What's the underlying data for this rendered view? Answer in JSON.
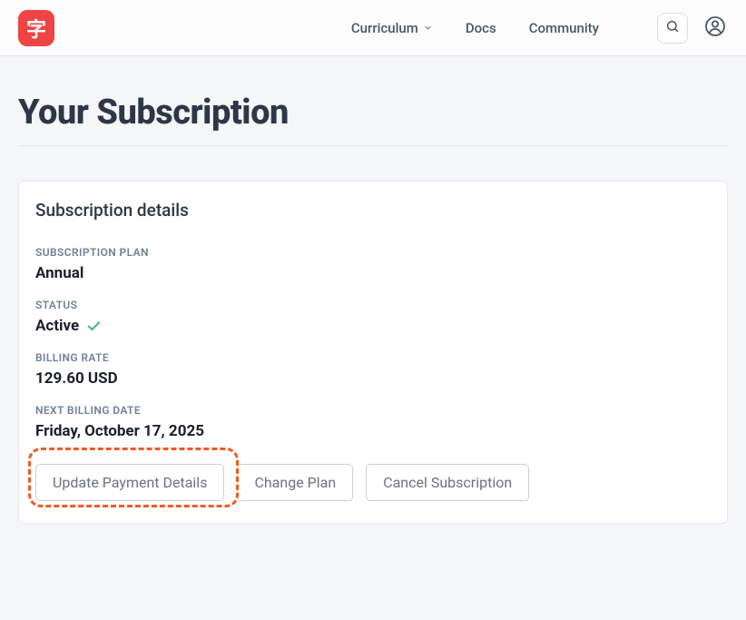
{
  "header": {
    "logo_char": "字",
    "nav": {
      "curriculum": "Curriculum",
      "docs": "Docs",
      "community": "Community"
    }
  },
  "page": {
    "title": "Your Subscription"
  },
  "card": {
    "title": "Subscription details",
    "labels": {
      "plan": "SUBSCRIPTION PLAN",
      "status": "STATUS",
      "billing_rate": "BILLING RATE",
      "next_billing": "NEXT BILLING DATE"
    },
    "values": {
      "plan": "Annual",
      "status": "Active",
      "billing_rate": "129.60 USD",
      "next_billing": "Friday, October 17, 2025"
    },
    "buttons": {
      "update_payment": "Update Payment Details",
      "change_plan": "Change Plan",
      "cancel_sub": "Cancel Subscription"
    }
  }
}
